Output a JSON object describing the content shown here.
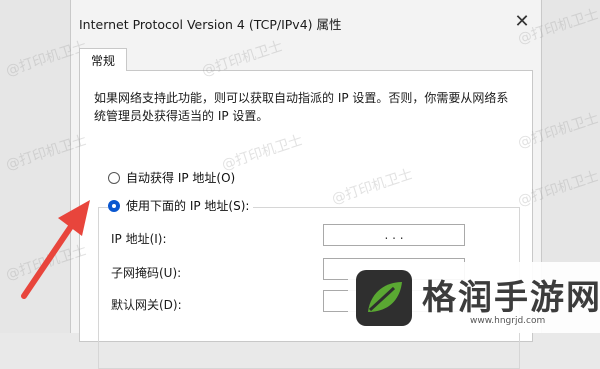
{
  "window": {
    "title": "Internet Protocol Version 4 (TCP/IPv4) 属性",
    "close_glyph": "✕"
  },
  "tabs": [
    {
      "label": "常规",
      "active": true
    }
  ],
  "description": "如果网络支持此功能，则可以获取自动指派的 IP 设置。否则，你需要从网络系统管理员处获得适当的 IP 设置。",
  "radio_options": {
    "auto": {
      "label": "自动获得 IP 地址(O)",
      "checked": false
    },
    "manual": {
      "label": "使用下面的 IP 地址(S):",
      "checked": true
    }
  },
  "fields": {
    "ip": {
      "label": "IP 地址(I):",
      "value": ". . ."
    },
    "subnet": {
      "label": "子网掩码(U):",
      "value": ". . ."
    },
    "gateway": {
      "label": "默认网关(D):",
      "value": ". . ."
    }
  },
  "watermark": {
    "text": "@打印机卫士"
  },
  "logo": {
    "text": "格润手游网",
    "url": "www.hngrjd.com"
  },
  "colors": {
    "accent": "#0b57d0",
    "arrow": "#e8453c",
    "logo_green": "#5aa832"
  }
}
